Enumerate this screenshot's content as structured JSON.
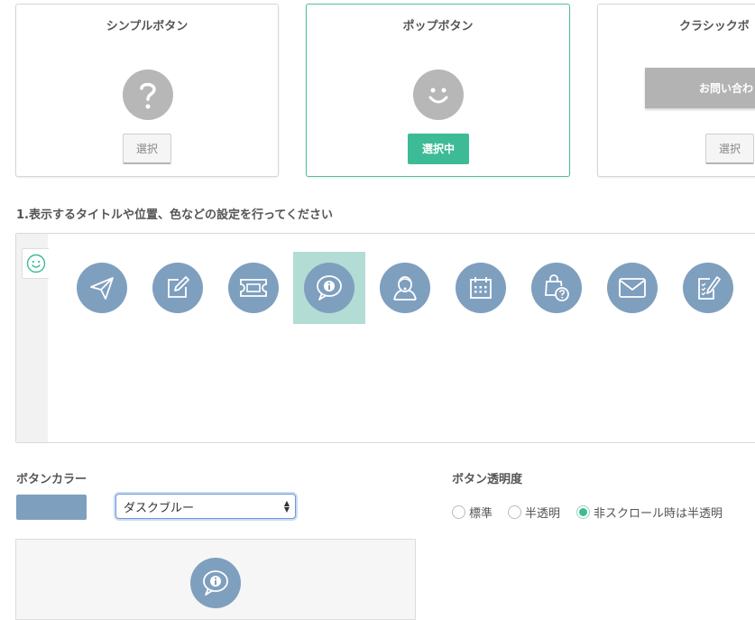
{
  "styles": {
    "simple": {
      "title": "シンプルボタン",
      "button": "選択"
    },
    "pop": {
      "title": "ポップボタン",
      "button": "選択中"
    },
    "classic": {
      "title": "クラシックボ",
      "sample": "お問い合わ",
      "button": "選択"
    }
  },
  "section1_heading": "1.表示するタイトルや位置、色などの設定を行ってください",
  "icons": [
    {
      "name": "paper-plane-icon",
      "selected": false
    },
    {
      "name": "edit-note-icon",
      "selected": false
    },
    {
      "name": "ticket-icon",
      "selected": false
    },
    {
      "name": "info-speech-bubble-icon",
      "selected": true
    },
    {
      "name": "support-person-icon",
      "selected": false
    },
    {
      "name": "calendar-icon",
      "selected": false
    },
    {
      "name": "shopping-bag-question-icon",
      "selected": false
    },
    {
      "name": "mail-icon",
      "selected": false
    },
    {
      "name": "checklist-edit-icon",
      "selected": false
    }
  ],
  "button_color": {
    "label": "ボタンカラー",
    "value": "ダスクブルー",
    "hex": "#7f9fbf"
  },
  "opacity": {
    "label": "ボタン透明度",
    "options": [
      "標準",
      "半透明",
      "非スクロール時は半透明"
    ],
    "selected": "非スクロール時は半透明"
  },
  "colors": {
    "accent": "#3dbb96",
    "icon_blue": "#7f9fbf",
    "highlight": "#b3ddd4"
  }
}
